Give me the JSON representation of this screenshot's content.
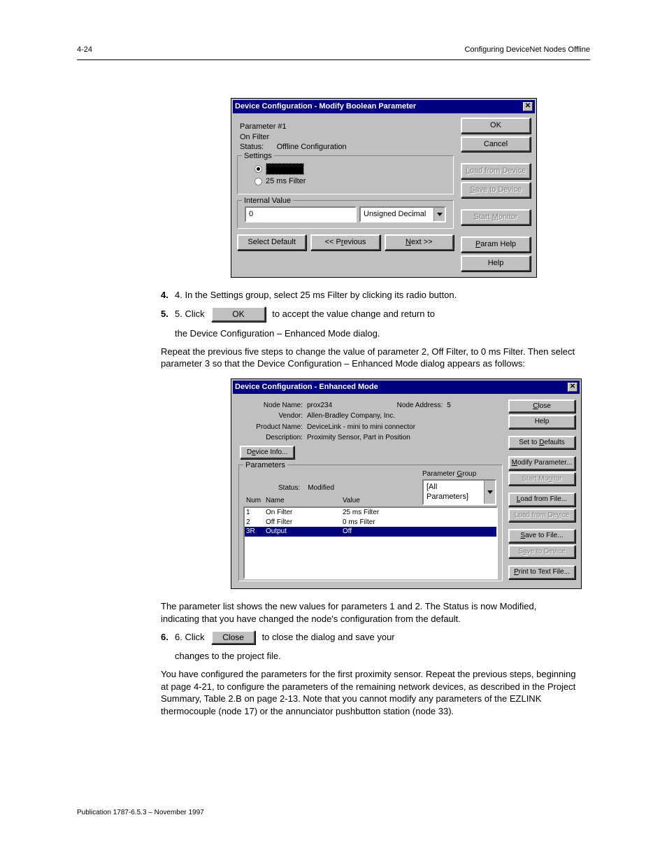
{
  "header": {
    "left": "4-24",
    "right": "Configuring DeviceNet Nodes Offline"
  },
  "dlg1": {
    "title": "Device Configuration - Modify Boolean Parameter",
    "paramNum": "Parameter #1",
    "paramName": "On Filter",
    "statusLabel": "Status:",
    "statusValue": "Offline Configuration",
    "settingsTitle": "Settings",
    "radio0": "0 ms Filter",
    "radio25": "25 ms Filter",
    "ivTitle": "Internal Value",
    "ivValue": "0",
    "ivType": "Unsigned Decimal",
    "selectDefault": "Select Default",
    "prev": "<< Previous",
    "next": "Next >>",
    "ok": "OK",
    "cancel": "Cancel",
    "loadFromDevice": "Load from Device",
    "saveToDevice": "Save to Device",
    "startMonitor": "Start Monitor",
    "paramHelp": "Param Help",
    "help": "Help"
  },
  "text1": {
    "line1": "4. In the Settings group, select 25 ms Filter by clicking its radio button.",
    "line2a": "5. Click",
    "line2b": "to accept the value change and return to",
    "okBtn": "OK",
    "line3": "the Device Configuration – Enhanced Mode dialog.",
    "line4": "Repeat the previous five steps to change the value of parameter 2, Off Filter, to 0 ms Filter. Then select parameter 3 so that the Device Configuration – Enhanced Mode dialog appears as follows:"
  },
  "dlg2": {
    "title": "Device Configuration - Enhanced Mode",
    "labels": {
      "nodeName": "Node Name:",
      "vendor": "Vendor:",
      "productName": "Product Name:",
      "description": "Description:",
      "nodeAddr": "Node Address:"
    },
    "values": {
      "nodeName": "prox234",
      "vendor": "Allen-Bradley Company, Inc.",
      "productName": "DeviceLink - mini to mini connector",
      "description": "Proximity Sensor, Part in Position",
      "nodeAddr": "5"
    },
    "deviceInfo": "Device Info...",
    "parametersTitle": "Parameters",
    "statusLabel": "Status:",
    "statusValue": "Modified",
    "paramGroupLabel": "Parameter Group",
    "paramGroupValue": "[All Parameters]",
    "cols": {
      "num": "Num",
      "name": "Name",
      "value": "Value"
    },
    "rows": [
      {
        "num": "1",
        "name": "On Filter",
        "value": "25 ms Filter"
      },
      {
        "num": "2",
        "name": "Off Filter",
        "value": "0 ms Filter"
      },
      {
        "num": "3R",
        "name": "Output",
        "value": "Off"
      }
    ],
    "btns": {
      "close": "Close",
      "help": "Help",
      "setDefaults": "Set to Defaults",
      "modifyParam": "Modify Parameter...",
      "startMonitor": "Start Monitor",
      "loadFromFile": "Load from File...",
      "loadFromDevice": "Load from Device",
      "saveToFile": "Save to File...",
      "saveToDevice": "Save to Device",
      "printToText": "Print to Text File..."
    }
  },
  "text2": {
    "line1": "The parameter list shows the new values for parameters 1 and 2. The Status is now Modified, indicating that you have changed the node's configuration from the default.",
    "line2a": "6. Click",
    "closeBtn": "Close",
    "line2b": "to close the dialog and save your",
    "line3": "changes to the project file.",
    "line4": "You have configured the parameters for the first proximity sensor. Repeat the previous steps, beginning at page 4-21, to configure the parameters of the remaining network devices, as described in the Project Summary, Table 2.B on page 2-13. Note that you cannot modify any parameters of the EZLINK thermocouple (node 17) or the annunciator pushbutton station (node 33)."
  },
  "footer": "Publication 1787-6.5.3 – November 1997"
}
